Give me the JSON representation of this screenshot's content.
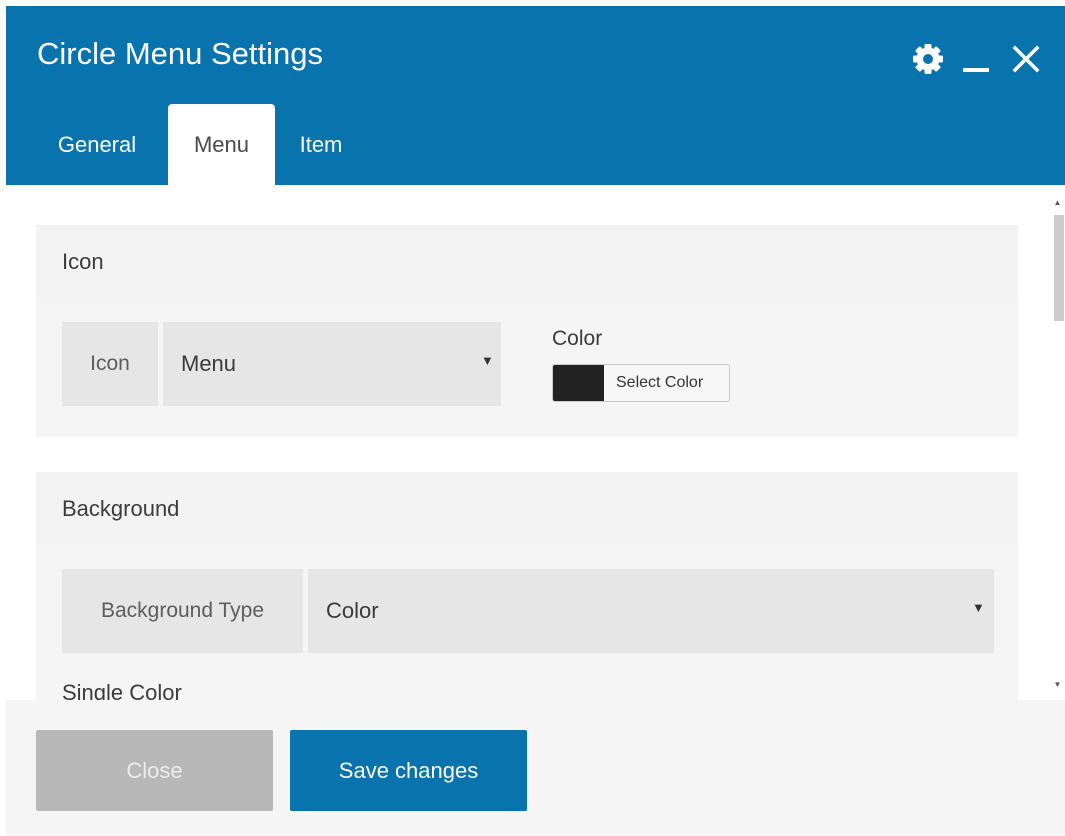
{
  "window": {
    "title": "Circle Menu Settings"
  },
  "tabs": [
    {
      "label": "General",
      "active": false
    },
    {
      "label": "Menu",
      "active": true
    },
    {
      "label": "Item",
      "active": false
    }
  ],
  "icons": {
    "settings": "gear-icon",
    "minimize": "minimize-icon",
    "close": "close-icon",
    "select_arrow": "caret-down-icon"
  },
  "sections": {
    "icon": {
      "title": "Icon",
      "field_label": "Icon",
      "select_value": "Menu",
      "color_label": "Color",
      "color_button": "Select Color",
      "color_value": "#222222"
    },
    "background": {
      "title": "Background",
      "field_label": "Background Type",
      "select_value": "Color",
      "single_color_label": "Single Color"
    }
  },
  "footer": {
    "close_label": "Close",
    "save_label": "Save changes"
  },
  "colors": {
    "header": "#0873ad",
    "primary_button": "#0873ad",
    "disabled_button": "#b8b8b8"
  }
}
